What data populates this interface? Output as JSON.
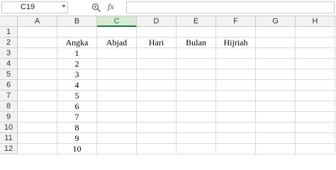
{
  "formula_bar": {
    "name_box": "C19",
    "formula_text": ""
  },
  "icons": {
    "zoom": "zoom-search-icon",
    "function": "fx-icon"
  },
  "fx_label": "fx",
  "columns": [
    "A",
    "B",
    "C",
    "D",
    "E",
    "F",
    "G",
    "H"
  ],
  "selected_column": "C",
  "rows": [
    {
      "num": "1",
      "cells": [
        "",
        "",
        "",
        "",
        "",
        "",
        "",
        ""
      ]
    },
    {
      "num": "2",
      "cells": [
        "",
        "Angka",
        "Abjad",
        "Hari",
        "Bulan",
        "Hijriah",
        "",
        ""
      ]
    },
    {
      "num": "3",
      "cells": [
        "",
        "1",
        "",
        "",
        "",
        "",
        "",
        ""
      ]
    },
    {
      "num": "4",
      "cells": [
        "",
        "2",
        "",
        "",
        "",
        "",
        "",
        ""
      ]
    },
    {
      "num": "5",
      "cells": [
        "",
        "3",
        "",
        "",
        "",
        "",
        "",
        ""
      ]
    },
    {
      "num": "6",
      "cells": [
        "",
        "4",
        "",
        "",
        "",
        "",
        "",
        ""
      ]
    },
    {
      "num": "7",
      "cells": [
        "",
        "5",
        "",
        "",
        "",
        "",
        "",
        ""
      ]
    },
    {
      "num": "8",
      "cells": [
        "",
        "6",
        "",
        "",
        "",
        "",
        "",
        ""
      ]
    },
    {
      "num": "9",
      "cells": [
        "",
        "7",
        "",
        "",
        "",
        "",
        "",
        ""
      ]
    },
    {
      "num": "10",
      "cells": [
        "",
        "8",
        "",
        "",
        "",
        "",
        "",
        ""
      ]
    },
    {
      "num": "11",
      "cells": [
        "",
        "9",
        "",
        "",
        "",
        "",
        "",
        ""
      ]
    },
    {
      "num": "12",
      "cells": [
        "",
        "10",
        "",
        "",
        "",
        "",
        "",
        ""
      ]
    }
  ]
}
